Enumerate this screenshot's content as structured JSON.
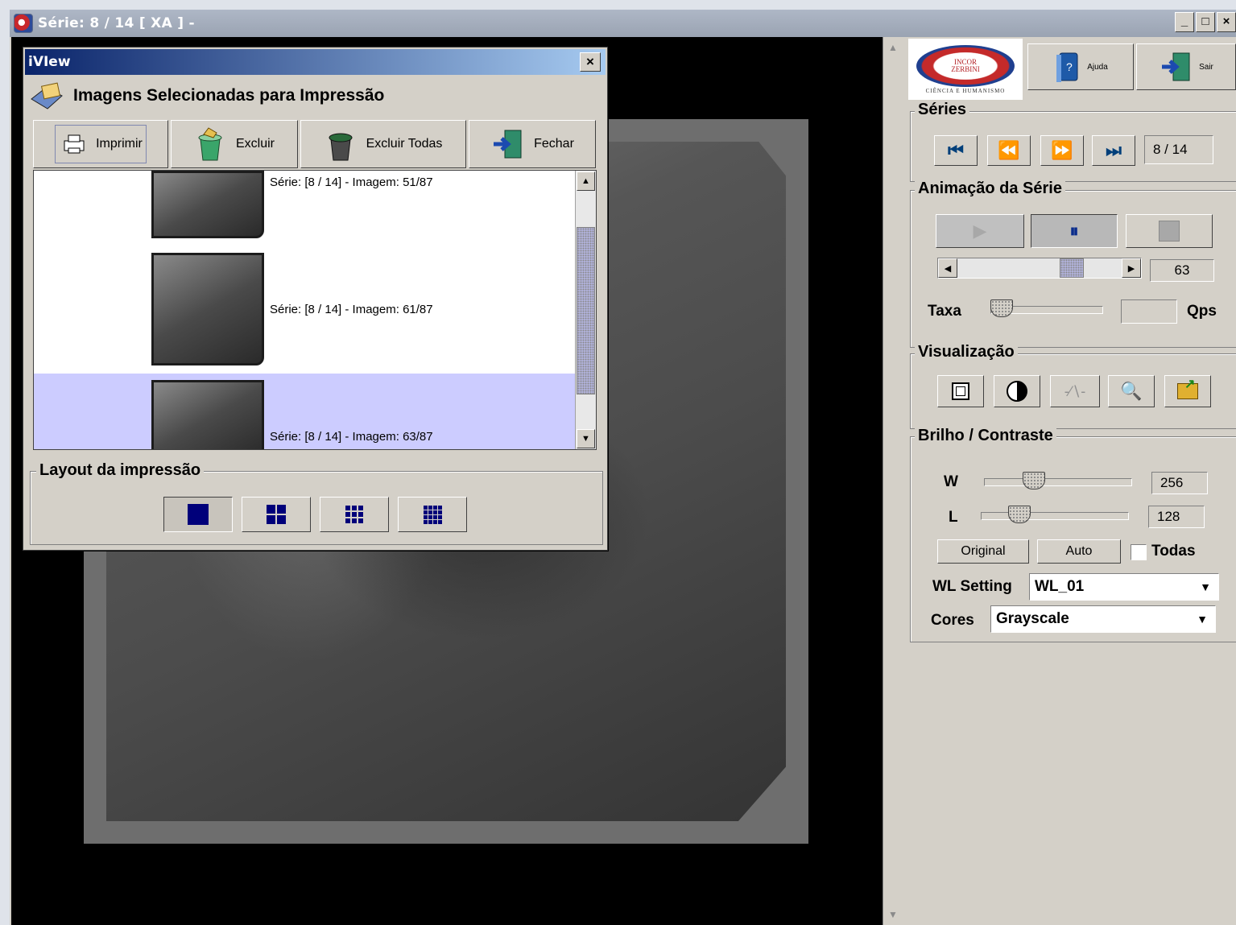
{
  "window": {
    "title": "Série: 8 / 14 [ XA ] -",
    "controls": [
      "_",
      "□",
      "×"
    ]
  },
  "dialog": {
    "title": "iVIew",
    "close_label": "×",
    "header": "Imagens Selecionadas para Impressão",
    "buttons": {
      "print": "Imprimir",
      "delete": "Excluir",
      "delete_all": "Excluir Todas",
      "close": "Fechar"
    },
    "images": [
      {
        "label": "Série: [8 / 14]  - Imagem: 51/87"
      },
      {
        "label": "Série: [8 / 14]  - Imagem: 61/87"
      },
      {
        "label": "Série: [8 / 14]  - Imagem: 63/87",
        "selected": true
      }
    ],
    "layout_title": "Layout da impressão",
    "layouts": [
      "1x1",
      "2x2",
      "3x3",
      "4x4"
    ],
    "selected_layout": "1x1"
  },
  "panel": {
    "logo": {
      "text": "INCOR\nZERBINI",
      "caption": "CIÊNCIA E HUMANISMO"
    },
    "toolbar": {
      "help": "Ajuda",
      "exit": "Sair"
    },
    "series": {
      "title": "Séries",
      "counter": "8 / 14",
      "nav_icons": [
        "first-icon",
        "previous-icon",
        "next-icon",
        "last-icon"
      ]
    },
    "animation": {
      "title": "Animação da Série",
      "frame": "63",
      "frame_fraction": 0.72,
      "rate_label": "Taxa",
      "rate_value": "",
      "rate_unit": "Qps",
      "rate_fraction": 0.0
    },
    "visualization": {
      "title": "Visualização",
      "tools": [
        "fit-icon",
        "invert-icon",
        "cine-icon",
        "zoom-icon",
        "export-icon"
      ]
    },
    "brightness": {
      "title": "Brilho / Contraste",
      "w_label": "W",
      "w_value": "256",
      "l_label": "L",
      "l_value": "128",
      "original": "Original",
      "auto": "Auto",
      "all_label": "Todas",
      "all_checked": false,
      "wl_setting_label": "WL Setting",
      "wl_setting_value": "WL_01",
      "colors_label": "Cores",
      "colors_value": "Grayscale"
    }
  }
}
